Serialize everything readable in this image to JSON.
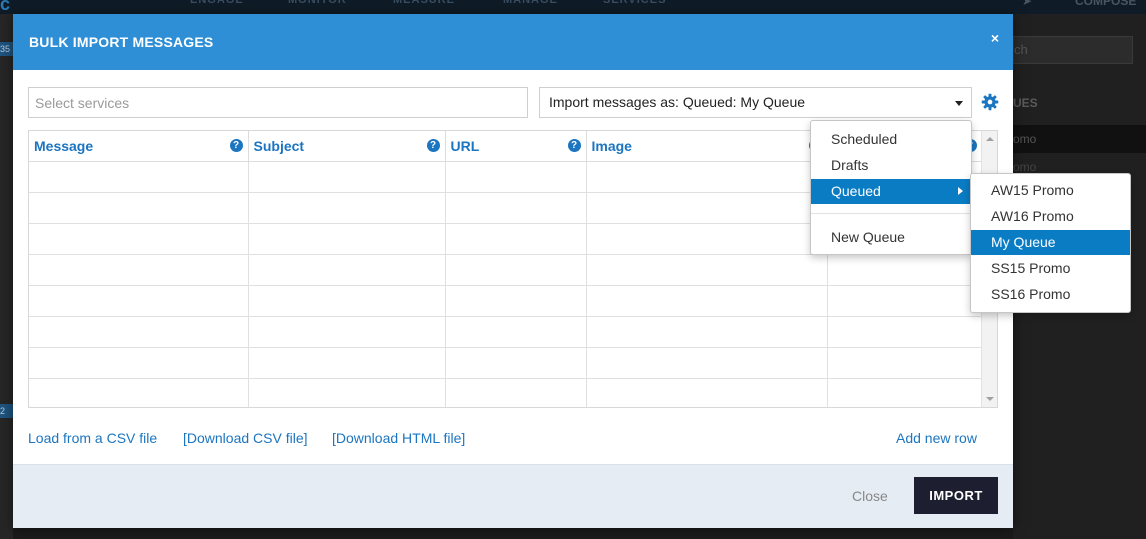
{
  "background": {
    "nav_items": [
      "ENGAGE",
      "MONITOR",
      "MEASURE",
      "MANAGE",
      "SERVICES"
    ],
    "compose_label": "COMPOSE",
    "search_placeholder": "ch",
    "side_title": "UES",
    "side_items": [
      "omo",
      "omo"
    ],
    "left_badges": [
      "35",
      "2"
    ]
  },
  "modal": {
    "title": "BULK IMPORT MESSAGES",
    "close_icon": "×",
    "services_placeholder": "Select services",
    "import_select_value": "Import messages as: Queued: My Queue",
    "columns": [
      {
        "label": "Message",
        "help": "?"
      },
      {
        "label": "Subject",
        "help": "?"
      },
      {
        "label": "URL",
        "help": "?"
      },
      {
        "label": "Image",
        "help": "?"
      },
      {
        "label": "",
        "help": "?"
      }
    ],
    "row_count": 8,
    "links": {
      "load_csv": "Load from a CSV file",
      "download_csv": "[Download CSV file]",
      "download_html": "[Download HTML file]",
      "add_row": "Add new row"
    },
    "footer": {
      "close_label": "Close",
      "import_label": "IMPORT"
    }
  },
  "dropdown": {
    "items": [
      "Scheduled",
      "Drafts",
      "Queued",
      "New Queue"
    ],
    "active": "Queued"
  },
  "submenu": {
    "items": [
      "AW15 Promo",
      "AW16 Promo",
      "My Queue",
      "SS15 Promo",
      "SS16 Promo"
    ],
    "active": "My Queue"
  },
  "colors": {
    "header_blue": "#2f8fd6",
    "link_blue": "#1c75c0",
    "menu_active": "#0a7cc4",
    "import_button": "#1d1f30",
    "footer_bg": "#e6ecf3"
  },
  "icons": {
    "settings": "gear-icon",
    "help": "question-circle-icon",
    "close": "close-icon",
    "select_caret": "caret-down-icon",
    "submenu_arrow": "caret-right-icon"
  }
}
